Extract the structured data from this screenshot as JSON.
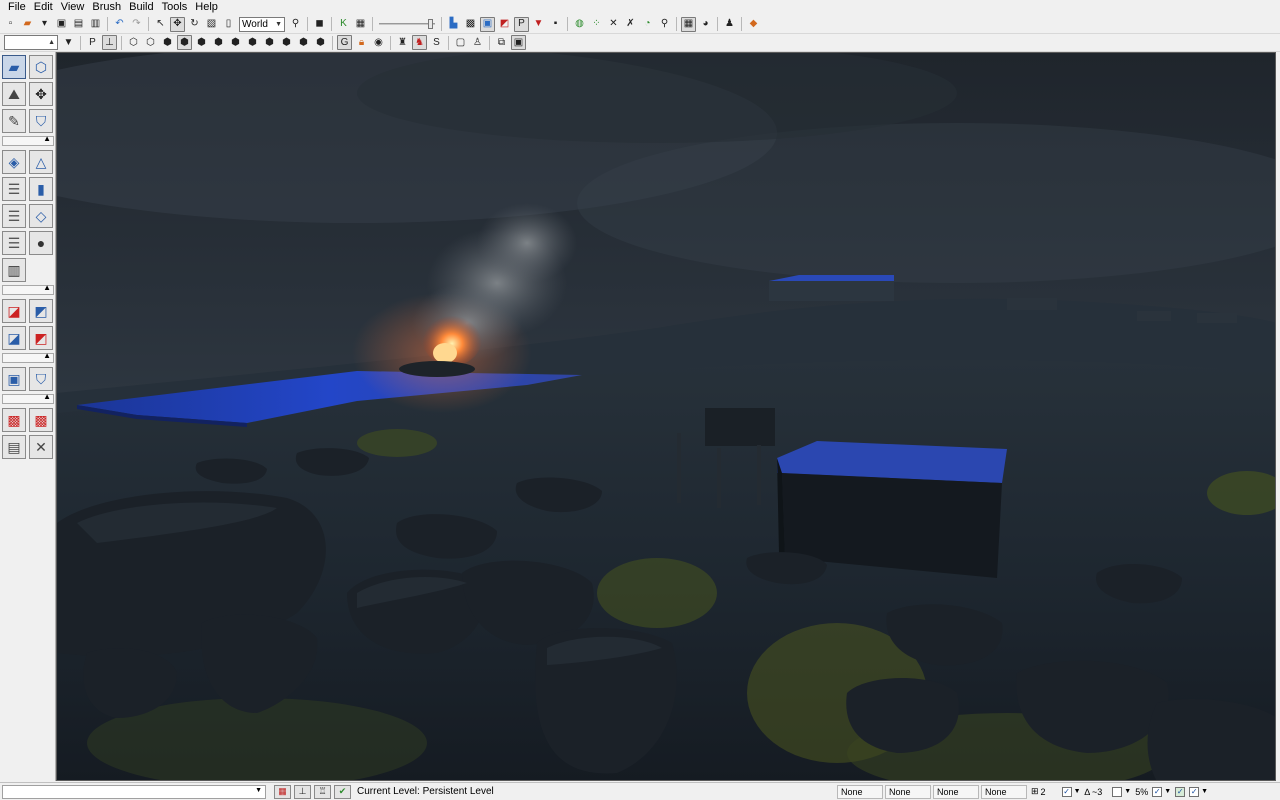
{
  "menu": [
    "File",
    "Edit",
    "View",
    "Brush",
    "Build",
    "Tools",
    "Help"
  ],
  "toolbar": {
    "coordinate_system": "World"
  },
  "statusbar": {
    "current_level_label": "Current Level:",
    "current_level_value": "Persistent Level",
    "fields": [
      "None",
      "None",
      "None",
      "None"
    ],
    "grid_value": "2",
    "rotation_snap_value": "~3",
    "scale_value": "5%"
  },
  "colors": {
    "water_blue": "#1c3cb4",
    "fire": "#ff6a2a",
    "sky": "#2b323b"
  }
}
